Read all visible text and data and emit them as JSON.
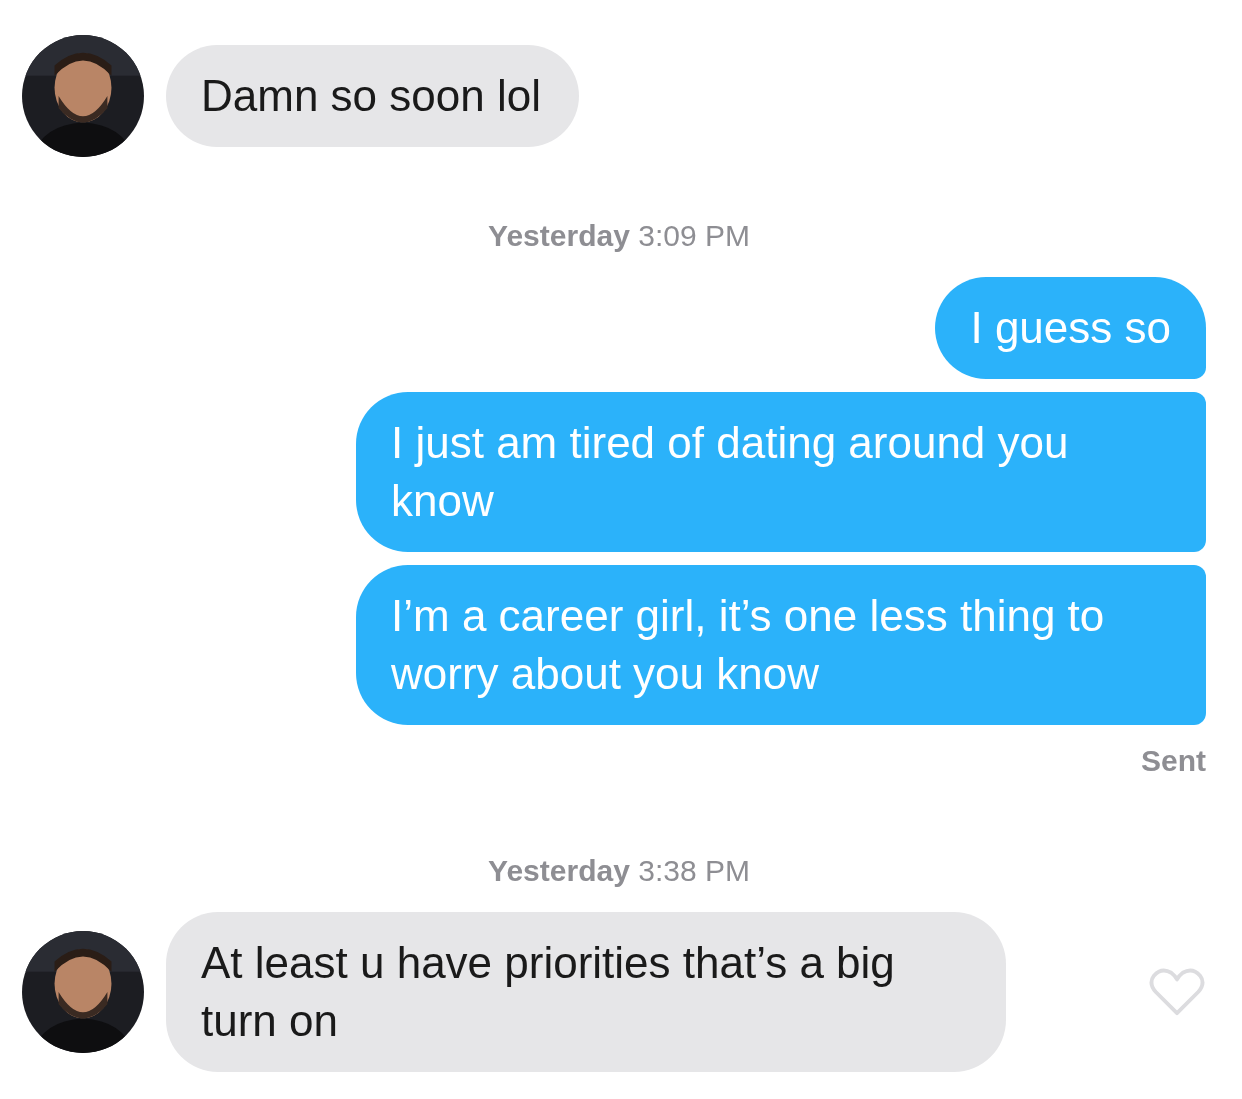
{
  "messages": [
    {
      "kind": "incoming",
      "text": "Damn so soon lol"
    },
    {
      "kind": "timestamp",
      "day": "Yesterday",
      "time": "3:09 PM"
    },
    {
      "kind": "outgoing",
      "text": "I guess so"
    },
    {
      "kind": "outgoing",
      "text": "I just am tired of dating around you know"
    },
    {
      "kind": "outgoing",
      "text": "I’m a career girl, it’s one less thing to worry about you know"
    },
    {
      "kind": "status",
      "text": "Sent"
    },
    {
      "kind": "timestamp",
      "day": "Yesterday",
      "time": "3:38 PM"
    },
    {
      "kind": "incoming",
      "text": "At least u have priorities that’s a big turn on",
      "liked": false
    }
  ]
}
